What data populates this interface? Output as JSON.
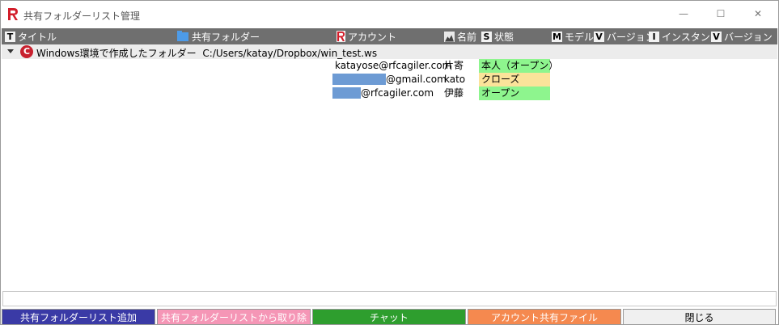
{
  "window": {
    "title": "共有フォルダーリスト管理",
    "minimize": "—",
    "maximize": "☐",
    "close": "✕"
  },
  "columns": [
    {
      "badge": "T",
      "label": "タイトル"
    },
    {
      "badge": "",
      "label": "共有フォルダー",
      "icon": "folder-icon"
    },
    {
      "badge": "",
      "label": "アカウント",
      "icon": "app-logo-icon"
    },
    {
      "badge": "",
      "label": "名前",
      "icon": "person-icon"
    },
    {
      "badge": "S",
      "label": "状態"
    },
    {
      "badge": "M",
      "label": "モデル"
    },
    {
      "badge": "V",
      "label": "バージョン"
    },
    {
      "badge": "I",
      "label": "インスタンス"
    },
    {
      "badge": "V",
      "label": "バージョン"
    }
  ],
  "group": {
    "icon_letter": "C",
    "title": "Windows環境で作成したフォルダー",
    "path": "C:/Users/katay/Dropbox/win_test.ws"
  },
  "rows": [
    {
      "account": "katayose@rfcagiler.com",
      "name": "片寄",
      "status": "本人（オープン）",
      "status_color": "#8ef58e"
    },
    {
      "account": "@gmail.com",
      "name": "kato",
      "status": "クローズ",
      "status_color": "#fbe39a"
    },
    {
      "account": "@rfcagiler.com",
      "name": "伊藤",
      "status": "オープン",
      "status_color": "#8ef58e"
    }
  ],
  "status_bar": "",
  "buttons": [
    {
      "label": "共有フォルダーリスト追加",
      "bg": "#3a3aa6",
      "fg": "#ffffff"
    },
    {
      "label": "共有フォルダーリストから取り除く",
      "bg": "#f596b6",
      "fg": "#ffffff"
    },
    {
      "label": "チャット",
      "bg": "#2e9e2e",
      "fg": "#ffffff"
    },
    {
      "label": "アカウント共有ファイル",
      "bg": "#f5894f",
      "fg": "#ffffff"
    },
    {
      "label": "閉じる",
      "bg": "#f0f0f0",
      "fg": "#000000"
    }
  ]
}
